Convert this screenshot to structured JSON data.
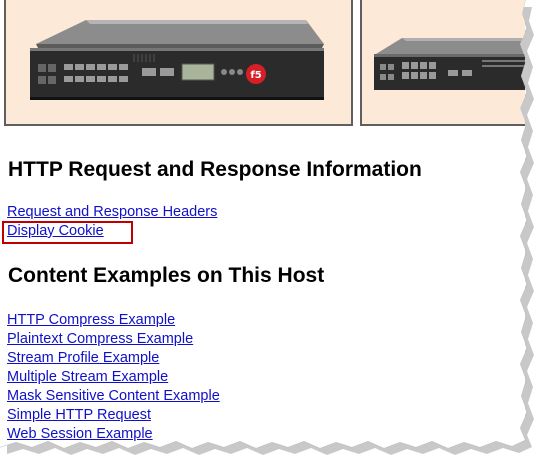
{
  "sections": [
    {
      "heading": "HTTP Request and Response Information",
      "links": [
        "Request and Response Headers",
        "Display Cookie"
      ]
    },
    {
      "heading": "Content Examples on This Host",
      "links": [
        "HTTP Compress Example",
        "Plaintext Compress Example",
        "Stream Profile Example",
        "Multiple Stream Example",
        "Mask Sensitive Content Example",
        "Simple HTTP Request",
        "Web Session Example"
      ]
    }
  ],
  "banner": {
    "background": "#fde9d7",
    "images": [
      "network-appliance-image",
      "network-appliance-image"
    ]
  },
  "colors": {
    "link": "#1010c8",
    "highlight": "#c00000",
    "panel_border": "#5f5f5f"
  },
  "highlighted_link": "Display Cookie"
}
